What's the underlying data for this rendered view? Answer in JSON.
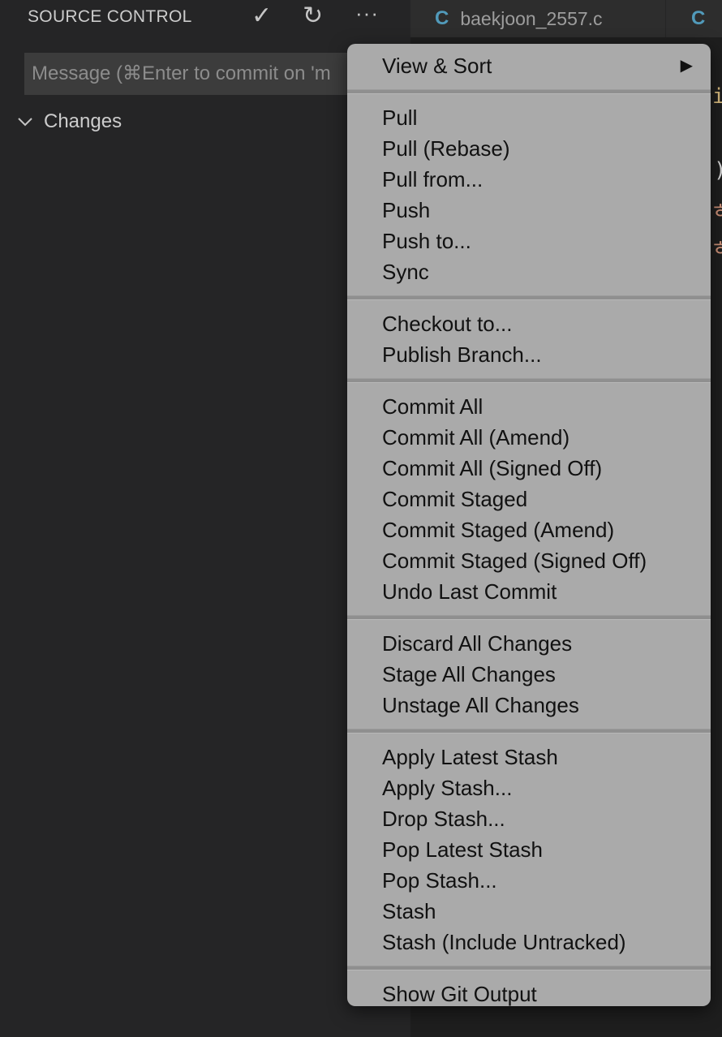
{
  "sidebar": {
    "title": "SOURCE CONTROL",
    "commit_icon": "checkmark-icon",
    "refresh_icon": "refresh-icon",
    "more_icon": "ellipsis-icon",
    "message_placeholder": "Message (⌘Enter to commit on 'm",
    "changes_label": "Changes"
  },
  "tabs": [
    {
      "icon": "C",
      "label": "baekjoon_2557.c"
    },
    {
      "icon": "C",
      "label": ""
    }
  ],
  "menu": {
    "view_sort": "View & Sort",
    "pull": "Pull",
    "pull_rebase": "Pull (Rebase)",
    "pull_from": "Pull from...",
    "push": "Push",
    "push_to": "Push to...",
    "sync": "Sync",
    "checkout_to": "Checkout to...",
    "publish_branch": "Publish Branch...",
    "commit_all": "Commit All",
    "commit_all_amend": "Commit All (Amend)",
    "commit_all_signed_off": "Commit All (Signed Off)",
    "commit_staged": "Commit Staged",
    "commit_staged_amend": "Commit Staged (Amend)",
    "commit_staged_signed_off": "Commit Staged (Signed Off)",
    "undo_last_commit": "Undo Last Commit",
    "discard_all_changes": "Discard All Changes",
    "stage_all_changes": "Stage All Changes",
    "unstage_all_changes": "Unstage All Changes",
    "apply_latest_stash": "Apply Latest Stash",
    "apply_stash": "Apply Stash...",
    "drop_stash": "Drop Stash...",
    "pop_latest_stash": "Pop Latest Stash",
    "pop_stash": "Pop Stash...",
    "stash": "Stash",
    "stash_include_untracked": "Stash (Include Untracked)",
    "show_git_output": "Show Git Output"
  },
  "colors": {
    "sidebar_bg": "#252526",
    "menu_bg": "#aaaaaa",
    "c_icon": "#519aba"
  }
}
